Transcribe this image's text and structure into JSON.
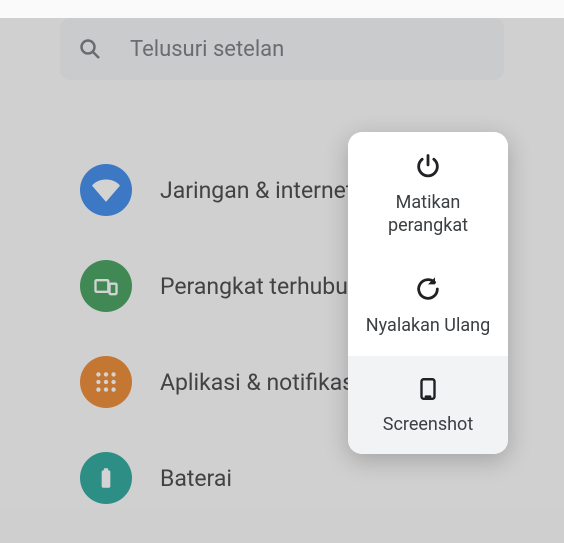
{
  "search": {
    "placeholder": "Telusuri setelan"
  },
  "settings": {
    "items": [
      {
        "label": "Jaringan & internet"
      },
      {
        "label": "Perangkat terhubung"
      },
      {
        "label": "Aplikasi & notifikasi"
      },
      {
        "label": "Baterai"
      }
    ]
  },
  "power_menu": {
    "items": [
      {
        "label": "Matikan perangkat"
      },
      {
        "label": "Nyalakan Ulang"
      },
      {
        "label": "Screenshot"
      }
    ]
  }
}
